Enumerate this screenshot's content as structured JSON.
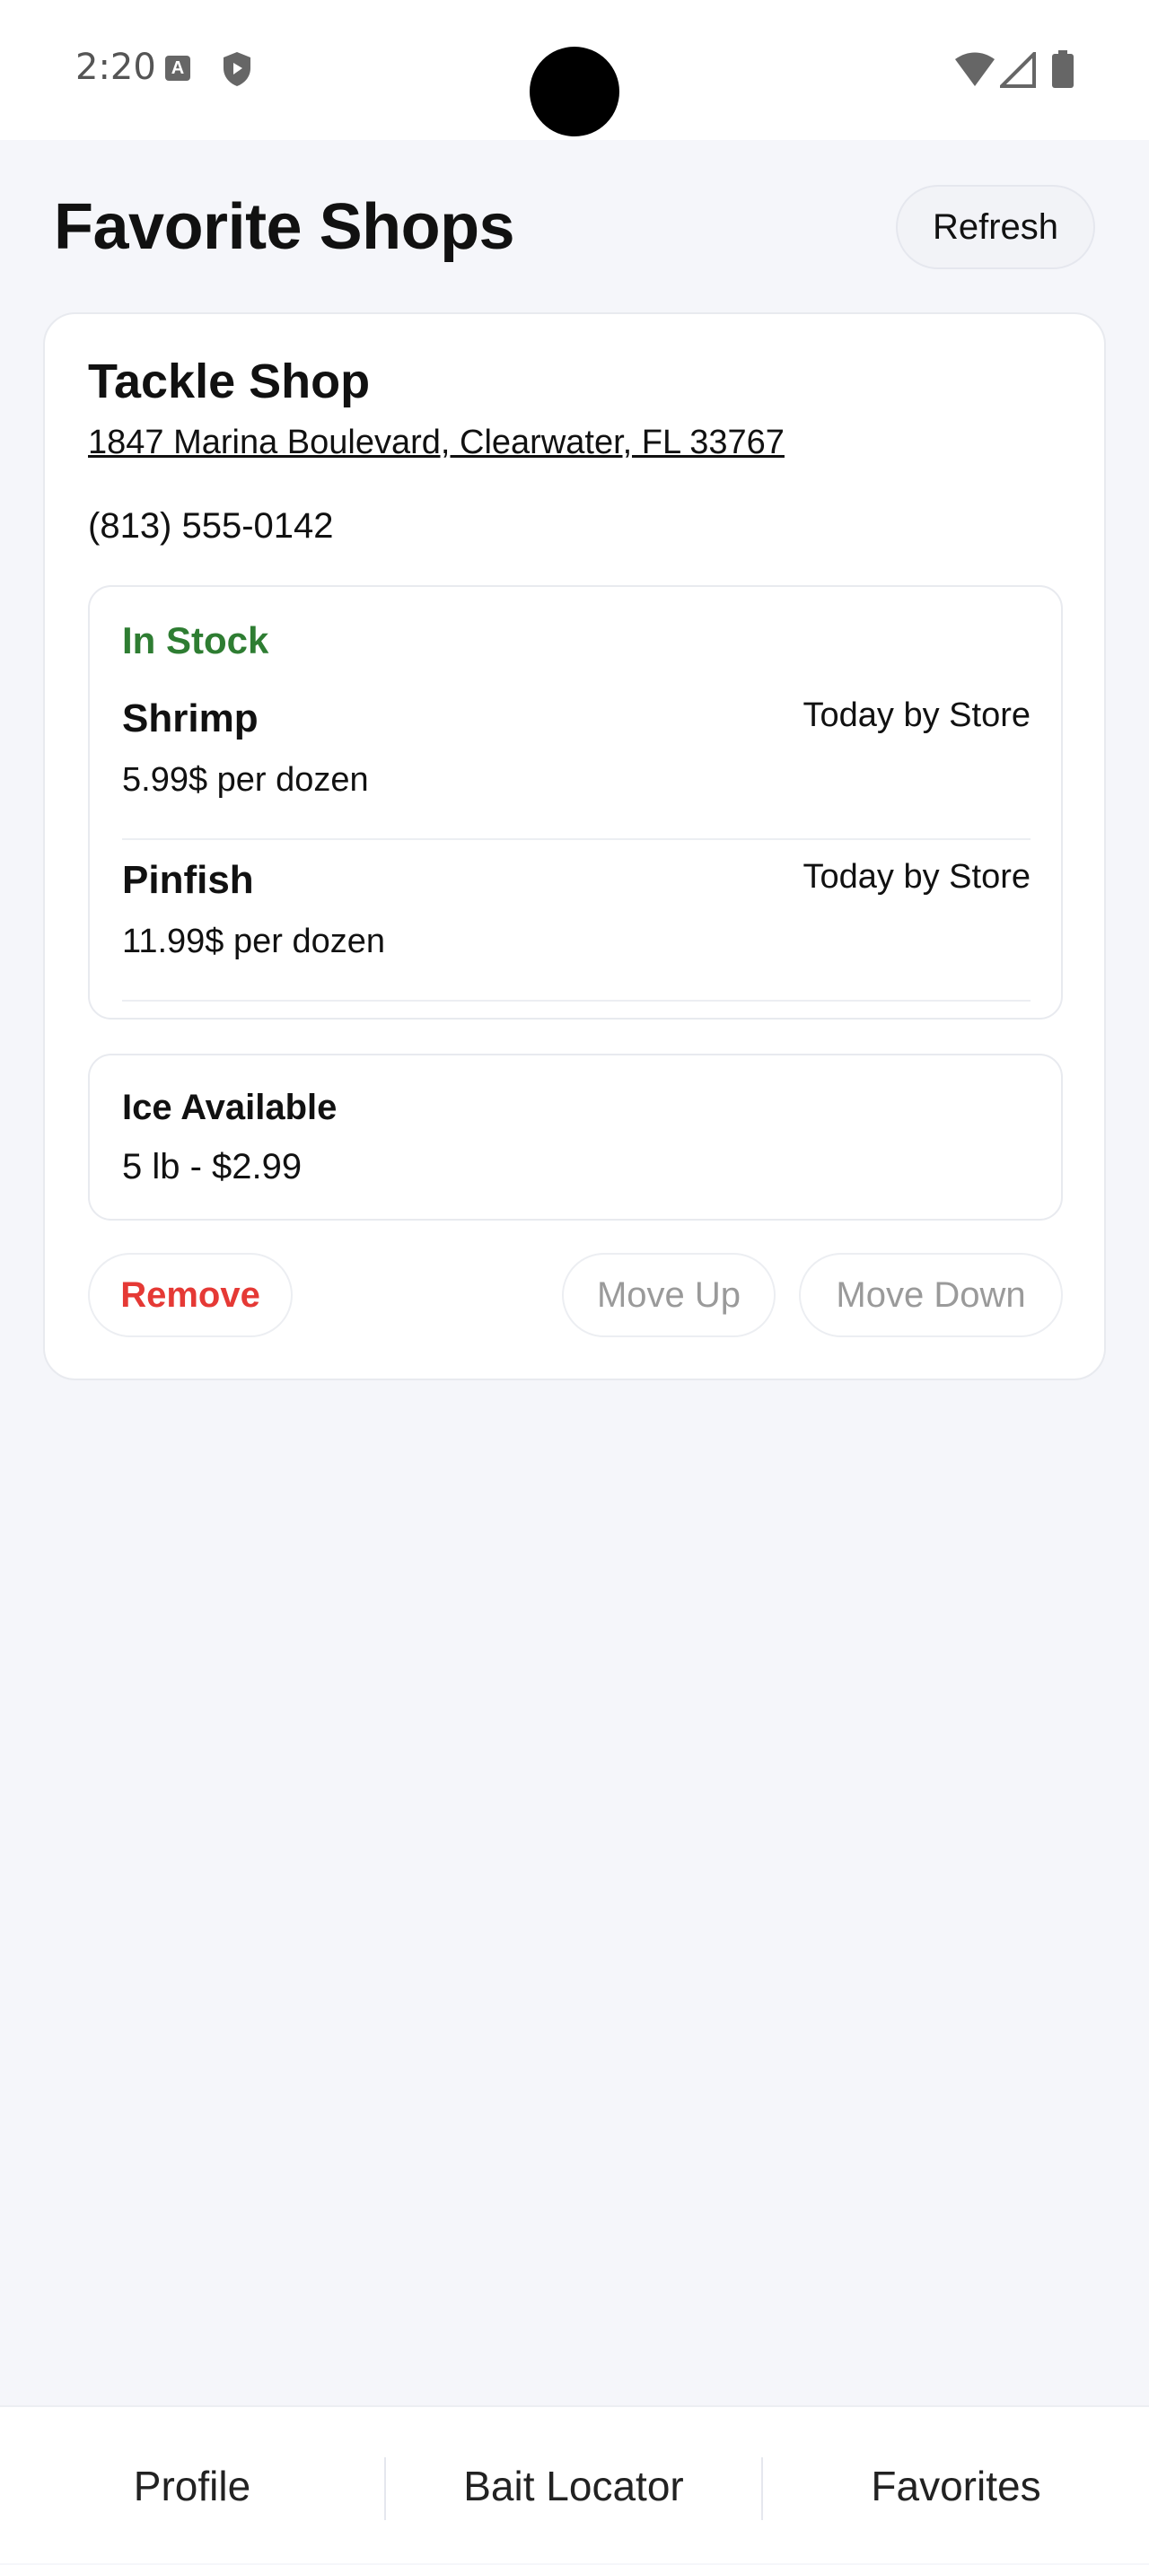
{
  "status_bar": {
    "time": "2:20",
    "icons": [
      "a-icon",
      "shield-icon",
      "wifi-icon",
      "signal-icon",
      "battery-icon"
    ]
  },
  "header": {
    "title": "Favorite Shops",
    "refresh_label": "Refresh"
  },
  "shop": {
    "name": "Tackle Shop",
    "address": "1847 Marina Boulevard, Clearwater, FL 33767",
    "phone": "(813) 555-0142",
    "stock": {
      "heading": "In Stock",
      "heading_color": "#2e7d32",
      "items": [
        {
          "name": "Shrimp",
          "price": "5.99$ per dozen",
          "source": "Today by Store"
        },
        {
          "name": "Pinfish",
          "price": "11.99$ per dozen",
          "source": "Today by Store"
        }
      ]
    },
    "ice": {
      "title": "Ice Available",
      "detail": "5 lb - $2.99"
    },
    "actions": {
      "remove_label": "Remove",
      "move_up_label": "Move Up",
      "move_down_label": "Move Down"
    }
  },
  "nav": {
    "tabs": [
      {
        "label": "Profile"
      },
      {
        "label": "Bait Locator"
      },
      {
        "label": "Favorites"
      }
    ]
  }
}
